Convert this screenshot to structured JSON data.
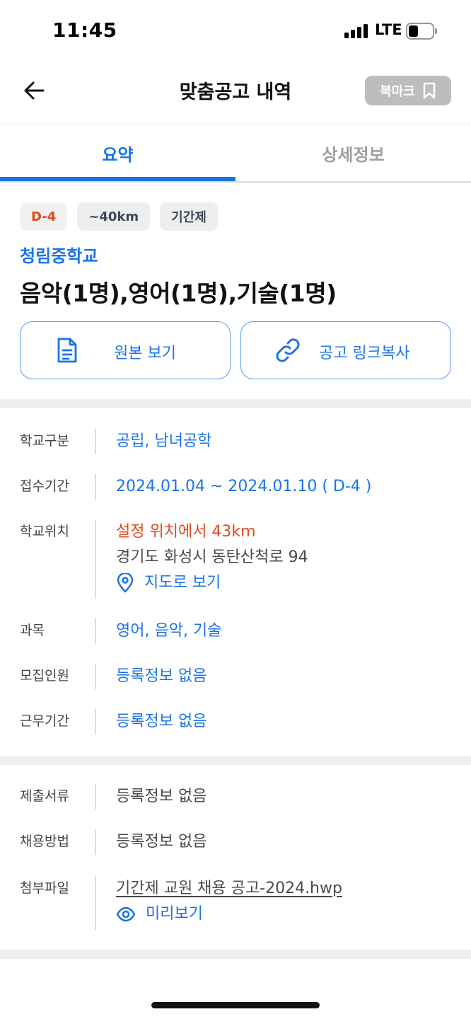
{
  "status": {
    "time": "11:45",
    "network": "LTE"
  },
  "header": {
    "title": "맞춤공고 내역",
    "bookmark_label": "북마크"
  },
  "tabs": [
    {
      "label": "요약",
      "active": true
    },
    {
      "label": "상세정보",
      "active": false
    }
  ],
  "summary": {
    "chips": [
      "D-4",
      "~40km",
      "기간제"
    ],
    "school_name": "청림중학교",
    "job_title": "음악(1명),영어(1명),기술(1명)",
    "original_button": "원본 보기",
    "copy_link_button": "공고 링크복사"
  },
  "info": {
    "school_type": {
      "label": "학교구분",
      "value": "공립, 남녀공학"
    },
    "reception": {
      "label": "접수기간",
      "value": "2024.01.04 ~ 2024.01.10 ( D-4 )"
    },
    "location": {
      "label": "학교위치",
      "distance": "설정 위치에서 43km",
      "address": "경기도 화성시 동탄산척로 94",
      "map_link": "지도로 보기"
    },
    "subjects": {
      "label": "과목",
      "value": "영어, 음악, 기술"
    },
    "recruits": {
      "label": "모집인원",
      "value": "등록정보 없음"
    },
    "work_period": {
      "label": "근무기간",
      "value": "등록정보 없음"
    }
  },
  "docs": {
    "documents": {
      "label": "제출서류",
      "value": "등록정보 없음"
    },
    "hiring_method": {
      "label": "채용방법",
      "value": "등록정보 없음"
    },
    "attachment": {
      "label": "첨부파일",
      "file": "기간제 교원 채용 공고-2024.hwp",
      "preview": "미리보기"
    }
  },
  "colors": {
    "accent": "#1a73e8",
    "warning": "#e2491a",
    "bookmark_bg": "#bdbdbd"
  }
}
